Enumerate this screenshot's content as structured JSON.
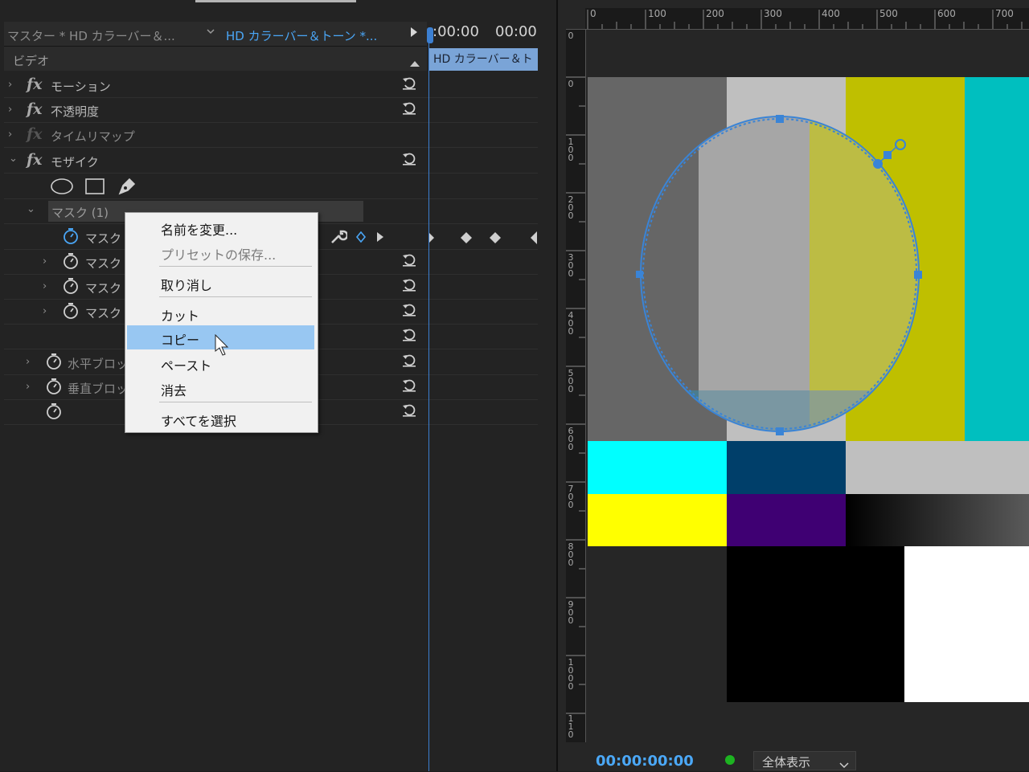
{
  "tabs": {
    "master": "マスター * HD カラーバー＆...",
    "sequence": "HD カラーバー＆トーン *..."
  },
  "timeline": {
    "time_start": ":00:00",
    "time_end": "00:00",
    "clip_label": "HD カラーバー＆ト"
  },
  "video_section": {
    "label": "ビデオ"
  },
  "effects": {
    "motion": "モーション",
    "opacity": "不透明度",
    "time_remap": "タイムリマップ",
    "mosaic": "モザイク"
  },
  "mask": {
    "header": "マスク (1)",
    "path_label": "マスク",
    "feather_label": "マスク",
    "opacity_label": "マスク",
    "expansion_label": "マスク"
  },
  "properties": {
    "horizontal_blocks": "水平ブロッ",
    "vertical_blocks": "垂直ブロッ"
  },
  "context_menu": {
    "items": [
      {
        "label": "名前を変更...",
        "enabled": true
      },
      {
        "label": "プリセットの保存...",
        "enabled": false
      },
      {
        "label": "取り消し",
        "enabled": true
      },
      {
        "label": "カット",
        "enabled": true
      },
      {
        "label": "コピー",
        "enabled": true,
        "highlighted": true
      },
      {
        "label": "ペースト",
        "enabled": true
      },
      {
        "label": "消去",
        "enabled": true
      },
      {
        "label": "すべてを選択",
        "enabled": true
      }
    ]
  },
  "ruler": {
    "h_labels": [
      "0",
      "100",
      "200",
      "300",
      "400",
      "500",
      "600",
      "700"
    ],
    "v_labels": [
      "0",
      "0",
      "100",
      "200",
      "300",
      "400",
      "500",
      "600",
      "700",
      "800",
      "900",
      "1000",
      "110"
    ]
  },
  "monitor": {
    "timecode": "00:00:00:00",
    "zoom_label": "全体表示",
    "status_color": "#1db321"
  },
  "colors": {
    "accent": "#4aa6f6",
    "menu_highlight": "#98c7f2",
    "mask_path": "#3a84d6"
  }
}
